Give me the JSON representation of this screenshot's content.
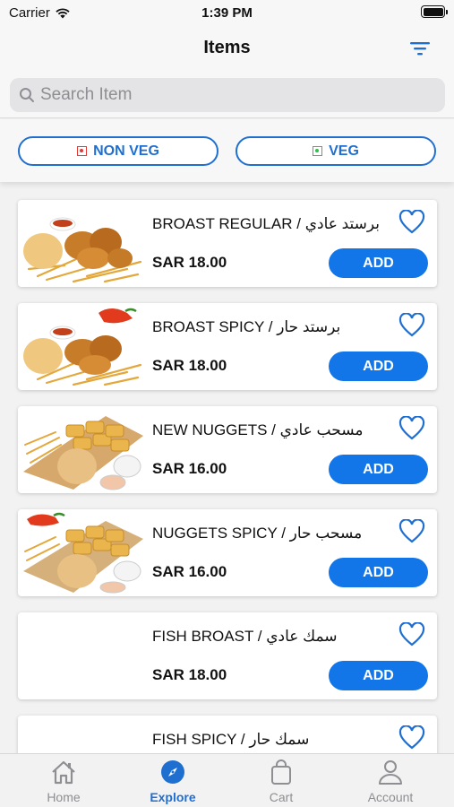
{
  "status": {
    "carrier": "Carrier",
    "time": "1:39 PM"
  },
  "nav": {
    "title": "Items",
    "filter_icon": "filter-icon"
  },
  "search": {
    "placeholder": "Search Item",
    "value": ""
  },
  "filters": {
    "non_veg": "NON VEG",
    "veg": "VEG"
  },
  "colors": {
    "accent": "#1275e8",
    "chip_border": "#1f6fd1",
    "non_veg": "#e53935",
    "veg": "#2fbf4a"
  },
  "items": [
    {
      "name": "BROAST REGULAR / برستد عادي",
      "price": "SAR 18.00",
      "add": "ADD",
      "image": "broast-regular"
    },
    {
      "name": "BROAST SPICY / برستد حار",
      "price": "SAR 18.00",
      "add": "ADD",
      "image": "broast-spicy"
    },
    {
      "name": "NEW NUGGETS / مسحب عادي",
      "price": "SAR 16.00",
      "add": "ADD",
      "image": "nuggets"
    },
    {
      "name": "NUGGETS SPICY / مسحب حار",
      "price": "SAR 16.00",
      "add": "ADD",
      "image": "nuggets-spicy"
    },
    {
      "name": "FISH BROAST / سمك عادي",
      "price": "SAR 18.00",
      "add": "ADD",
      "image": ""
    },
    {
      "name": "FISH SPICY / سمك حار",
      "price": "",
      "add": "",
      "image": ""
    }
  ],
  "tabs": [
    {
      "label": "Home",
      "icon": "home-icon",
      "active": false
    },
    {
      "label": "Explore",
      "icon": "compass-icon",
      "active": true
    },
    {
      "label": "Cart",
      "icon": "bag-icon",
      "active": false
    },
    {
      "label": "Account",
      "icon": "person-icon",
      "active": false
    }
  ],
  "battery_level": 1.0
}
